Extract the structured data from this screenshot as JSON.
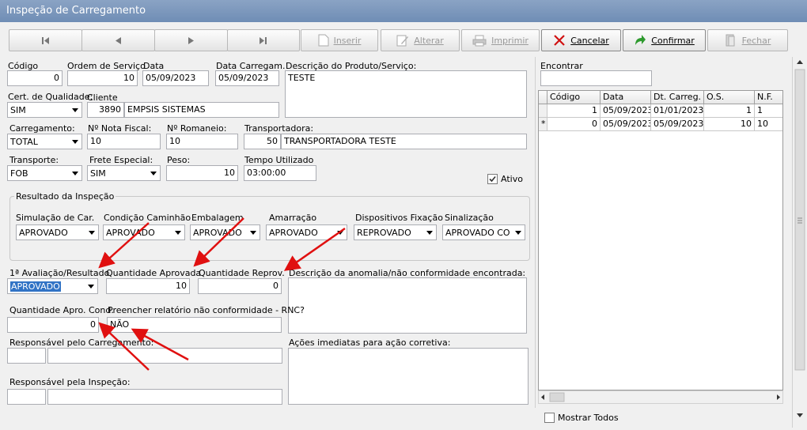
{
  "window": {
    "title": "Inspeção de Carregamento"
  },
  "toolbar": {
    "insert_label": "Inserir",
    "edit_label": "Alterar",
    "print_label": "Imprimir",
    "cancel_label": "Cancelar",
    "confirm_label": "Confirmar",
    "close_label": "Fechar"
  },
  "form": {
    "codigo": {
      "label": "Código",
      "value": "0"
    },
    "ordem_servico": {
      "label": "Ordem de Serviço",
      "value": "10"
    },
    "data": {
      "label": "Data",
      "value": "05/09/2023"
    },
    "data_carregam": {
      "label": "Data Carregam.",
      "value": "05/09/2023"
    },
    "descricao_produto": {
      "label": "Descrição do Produto/Serviço:",
      "value": "TESTE"
    },
    "cert_qualidade": {
      "label": "Cert. de Qualidade:",
      "value": "SIM"
    },
    "cliente": {
      "label": "Cliente",
      "code": "3890",
      "name": "EMPSIS SISTEMAS"
    },
    "carregamento": {
      "label": "Carregamento:",
      "value": "TOTAL"
    },
    "nota_fiscal": {
      "label": "Nº Nota Fiscal:",
      "value": "10"
    },
    "romaneio": {
      "label": "Nº Romaneio:",
      "value": "10"
    },
    "transportadora": {
      "label": "Transportadora:",
      "code": "50",
      "name": "TRANSPORTADORA TESTE"
    },
    "transporte": {
      "label": "Transporte:",
      "value": "FOB"
    },
    "frete_especial": {
      "label": "Frete Especial:",
      "value": "SIM"
    },
    "peso": {
      "label": "Peso:",
      "value": "10"
    },
    "tempo_utilizado": {
      "label": "Tempo Utilizado",
      "value": "03:00:00"
    },
    "ativo": {
      "label": "Ativo",
      "checked": true
    }
  },
  "resultado": {
    "title": "Resultado da Inspeção",
    "fields": [
      {
        "label": "Simulação de Car.",
        "value": "APROVADO"
      },
      {
        "label": "Condição Caminhão",
        "value": "APROVADO"
      },
      {
        "label": "Embalagem",
        "value": "APROVADO"
      },
      {
        "label": "Amarração",
        "value": "APROVADO"
      },
      {
        "label": "Dispositivos Fixação",
        "value": "REPROVADO"
      },
      {
        "label": "Sinalização",
        "value": "APROVADO CONI"
      }
    ]
  },
  "avaliacao": {
    "primeira": {
      "label": "1ª Avaliação/Resultado",
      "value": "APROVADO"
    },
    "qtd_aprovada": {
      "label": "Quantidade Aprovada",
      "value": "10"
    },
    "qtd_reprov": {
      "label": "Quantidade Reprov.",
      "value": "0"
    },
    "descricao_anomalia": {
      "label": "Descrição da anomalia/não conformidade encontrada:",
      "value": ""
    },
    "qtd_apro_cond": {
      "label": "Quantidade Apro. Cond.",
      "value": "0"
    },
    "rnc": {
      "label": "Preencher relatório não conformidade - RNC?",
      "value": "NÃO"
    },
    "resp_carregamento": {
      "label": "Responsável pelo Carregamento:",
      "code": "",
      "name": ""
    },
    "acoes_imediatas": {
      "label": "Ações imediatas para ação corretiva:",
      "value": ""
    },
    "resp_inspecao": {
      "label": "Responsável pela Inspeção:",
      "code": "",
      "name": ""
    }
  },
  "search": {
    "label": "Encontrar",
    "value": "",
    "columns": [
      "Código",
      "Data",
      "Dt. Carreg.",
      "O.S.",
      "N.F."
    ],
    "rows": [
      {
        "indicator": "",
        "cells": [
          "1",
          "05/09/2023",
          "01/01/2023",
          "1",
          "1"
        ]
      },
      {
        "indicator": "*",
        "cells": [
          "0",
          "05/09/2023",
          "05/09/2023",
          "10",
          "10"
        ]
      }
    ],
    "show_all_label": "Mostrar Todos"
  },
  "colors": {
    "title_bar": "#7393ba",
    "selection": "#3173c5",
    "annotation_arrow": "#e01010"
  }
}
